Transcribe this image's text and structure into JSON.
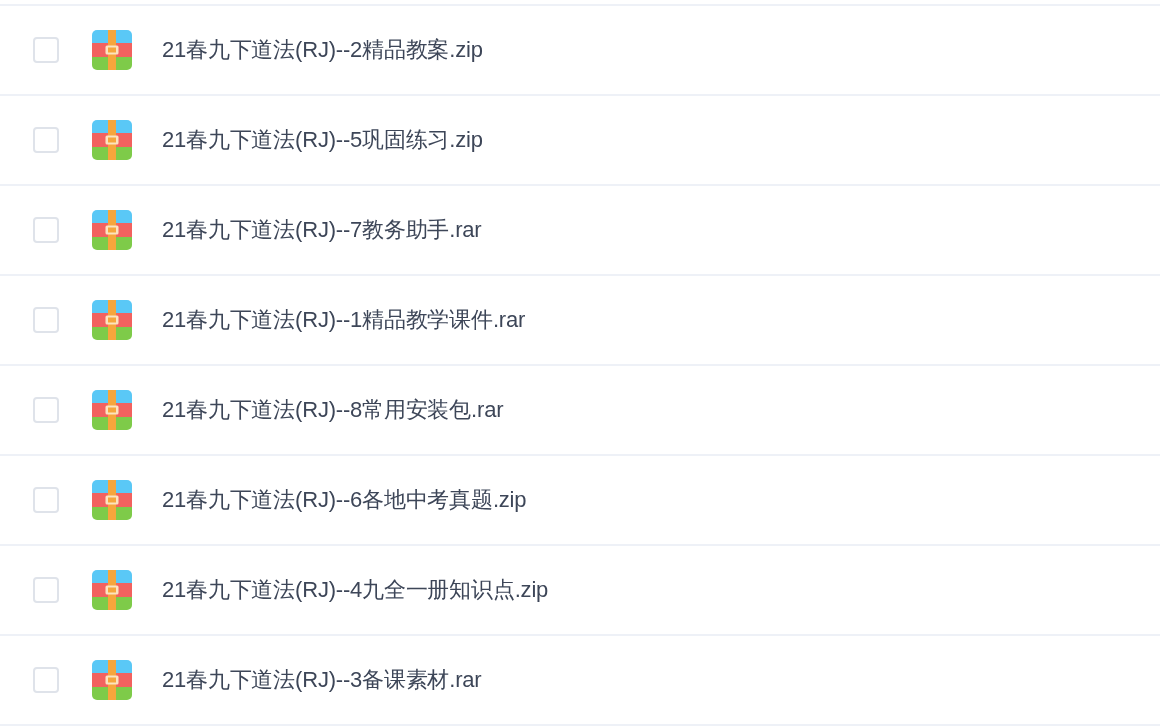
{
  "files": [
    {
      "name": "21春九下道法(RJ)--2精品教案.zip",
      "checked": false
    },
    {
      "name": "21春九下道法(RJ)--5巩固练习.zip",
      "checked": false
    },
    {
      "name": "21春九下道法(RJ)--7教务助手.rar",
      "checked": false
    },
    {
      "name": "21春九下道法(RJ)--1精品教学课件.rar",
      "checked": false
    },
    {
      "name": "21春九下道法(RJ)--8常用安装包.rar",
      "checked": false
    },
    {
      "name": "21春九下道法(RJ)--6各地中考真题.zip",
      "checked": false
    },
    {
      "name": "21春九下道法(RJ)--4九全一册知识点.zip",
      "checked": false
    },
    {
      "name": "21春九下道法(RJ)--3备课素材.rar",
      "checked": false
    }
  ]
}
